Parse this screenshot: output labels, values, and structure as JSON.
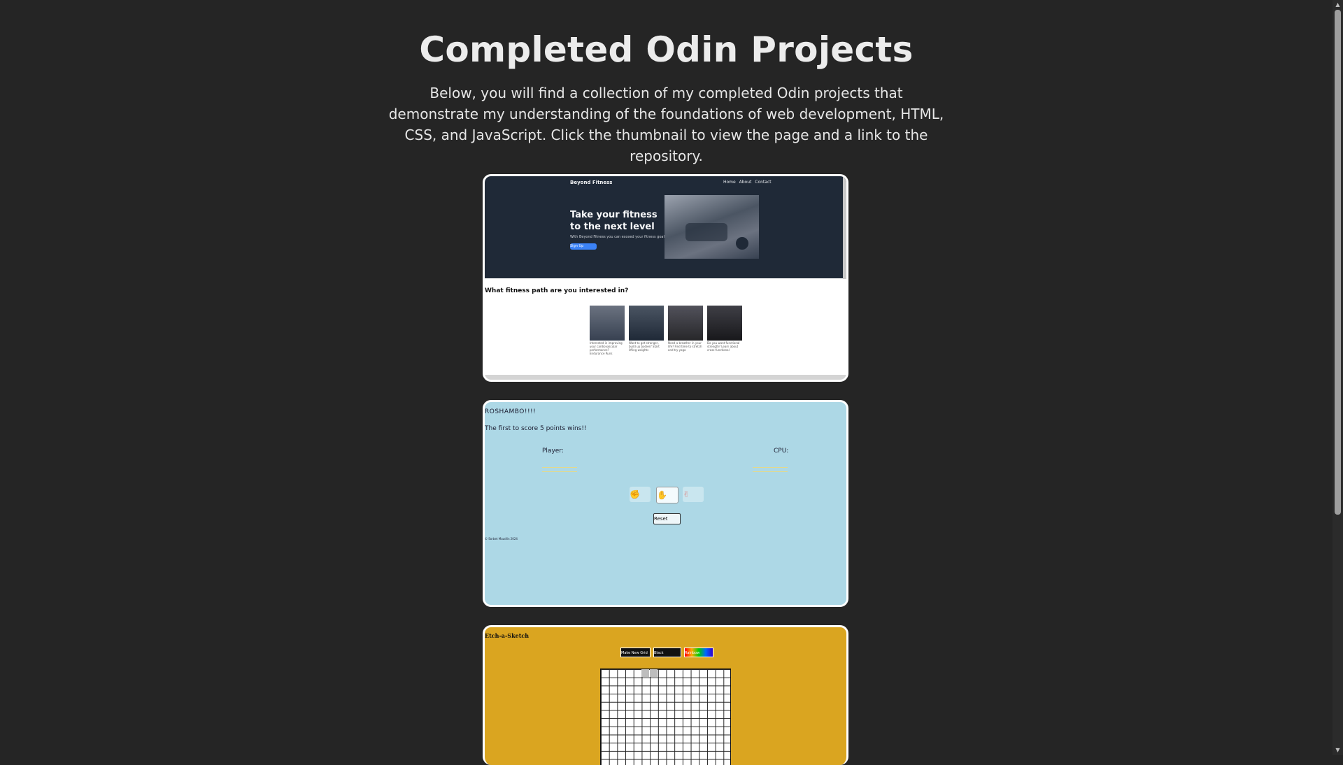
{
  "page": {
    "title": "Completed Odin Projects",
    "intro": "Below, you will find a collection of my completed Odin projects that demonstrate my understanding of the foundations of web development, HTML, CSS, and JavaScript. Click the thumbnail to view the page and a link to the repository."
  },
  "projects": [
    {
      "brand": "Beyond Fitness",
      "nav": "Home About Contact",
      "hero_title": "Take your fitness to the next level",
      "hero_sub": "With Beyond Fitness you can exceed your fitness goals!",
      "cta": "Sign Up",
      "section_title": "What fitness path are you interested in?",
      "captions": [
        "Interested in improving your cardiovascular performance? Endurance Runs",
        "Want to get stronger, build up bodies? Start lifting weights",
        "Need a breather in your life? Find time to stretch and try yoga",
        "Do you want functional strength? Learn about cross-functional"
      ],
      "colors": {
        "hero_bg": "#1f2937",
        "cta_bg": "#3b82f6"
      }
    },
    {
      "title": "ROSHAMBO!!!!",
      "subtitle": "The first to score 5 points wins!!",
      "player_label": "Player:",
      "cpu_label": "CPU:",
      "choices": [
        "✊",
        "✋",
        "✌"
      ],
      "reset_label": "Reset",
      "footer": "© Sorbet Maudlin 2024",
      "colors": {
        "bg": "#add8e6"
      }
    },
    {
      "title": "Etch-a-Sketch",
      "buttons": [
        "Make New Grid",
        "Black",
        "Rainbow"
      ],
      "colors": {
        "bg": "#daa520"
      }
    }
  ]
}
